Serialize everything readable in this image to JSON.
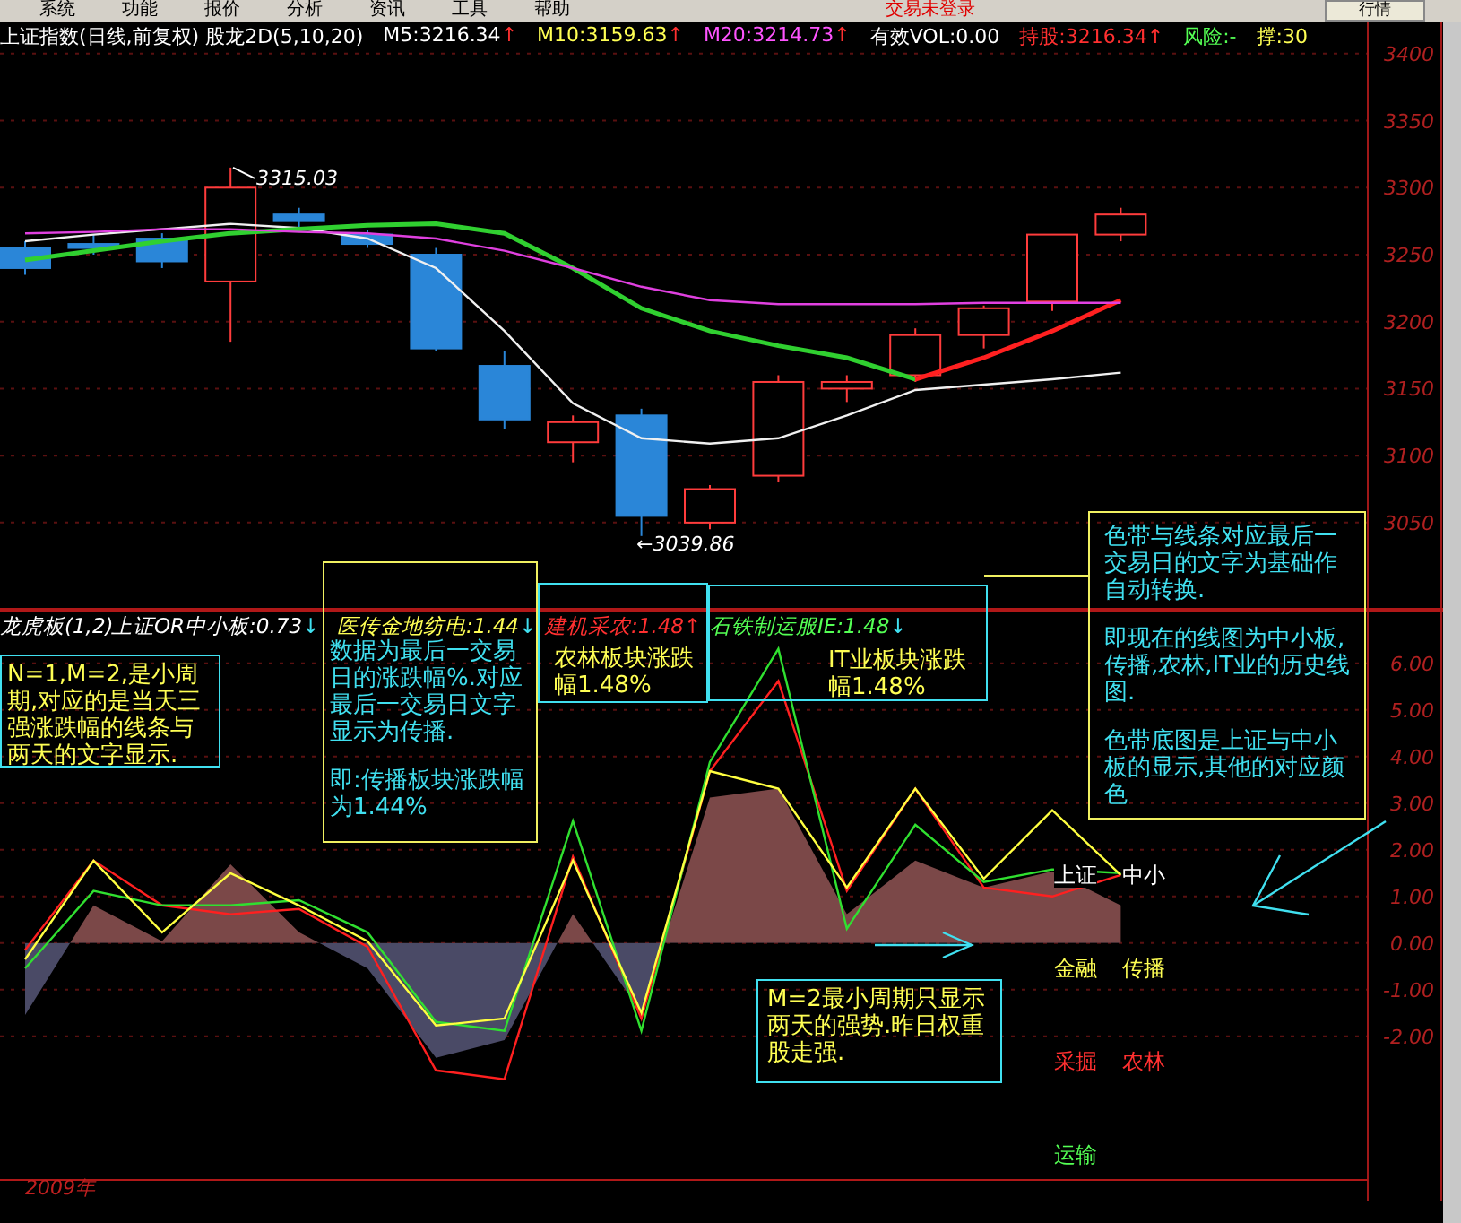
{
  "menu": {
    "items": [
      {
        "label": "系统"
      },
      {
        "label": "功能"
      },
      {
        "label": "报价"
      },
      {
        "label": "分析"
      },
      {
        "label": "资讯"
      },
      {
        "label": "工具"
      },
      {
        "label": "帮助"
      }
    ],
    "login_status": "交易未登录",
    "buttons": [
      "行情"
    ]
  },
  "header": {
    "title": "上证指数(日线,前复权) 股龙2D(5,10,20)",
    "stats": [
      {
        "label": "M5:3216.34",
        "arrow": {
          "text": "↑",
          "color": "#ff3030"
        },
        "color": "#ffffff"
      },
      {
        "label": "M10:3159.63",
        "arrow": {
          "text": "↑",
          "color": "#ff3030"
        },
        "color": "#ffff54"
      },
      {
        "label": "M20:3214.73",
        "arrow": {
          "text": "↑",
          "color": "#ff3030"
        },
        "color": "#ff54ff"
      },
      {
        "label": "有效VOL:0.00",
        "color": "#ffffff"
      },
      {
        "label": "持股:3216.34",
        "arrow": {
          "text": "↑",
          "color": "#ff3030"
        },
        "color": "#ff3030"
      },
      {
        "label": "风险:-",
        "color": "#54ff54"
      },
      {
        "label": "撑:30",
        "color": "#ffff54"
      }
    ]
  },
  "price_chart": {
    "high_label": "3315.03",
    "low_label": "←3039.86",
    "chart_data": {
      "type": "line",
      "grid": true,
      "ylim": [
        2985,
        3424
      ],
      "yticks": [
        3050,
        3100,
        3150,
        3200,
        3250,
        3300,
        3350,
        3400
      ],
      "series": [
        {
          "color": "#f0f0f0",
          "values": [
            3260,
            3265,
            3269,
            3273,
            3270,
            3262,
            3240,
            3193,
            3139,
            3113,
            3109,
            3113,
            3130,
            3149,
            3153,
            3157,
            3162
          ]
        },
        {
          "color": "#30d030",
          "values": [
            3246,
            3253,
            3260,
            3266,
            3269,
            3272,
            3273,
            3266,
            3240,
            3210,
            3193,
            3182,
            3173,
            3157,
            null,
            null,
            null
          ]
        },
        {
          "color": "#ff2020",
          "values": [
            null,
            null,
            null,
            null,
            null,
            null,
            null,
            null,
            null,
            null,
            null,
            null,
            null,
            3157,
            3173,
            3193,
            3216
          ]
        },
        {
          "color": "#e040e0",
          "values": [
            3266,
            3267,
            3269,
            3269,
            3267,
            3266,
            3262,
            3253,
            3240,
            3226,
            3216,
            3213,
            3213,
            3213,
            3214,
            3214,
            3214
          ]
        }
      ]
    }
  },
  "indicator": {
    "name": "龙虎板(1,2)",
    "values": [
      {
        "label": "上证OR中小板:0.73",
        "arrow": {
          "text": "↓",
          "color": "#40e0f0"
        },
        "color": "#ffffff"
      },
      {
        "label": "医传金地纺电:1.44",
        "arrow": {
          "text": "↓",
          "color": "#40e0f0"
        },
        "color": "#ffff54"
      },
      {
        "label": "建机采农:1.48",
        "arrow": {
          "text": "↑",
          "color": "#ff3030"
        },
        "color": "#ff3030"
      },
      {
        "label": "石铁制运服IE:1.48",
        "arrow": {
          "text": "↓",
          "color": "#40e0f0"
        },
        "color": "#54ff54"
      }
    ],
    "chart_data": {
      "type": "line",
      "grid": true,
      "ylim": [
        -5.08,
        7.15
      ],
      "yticks": [
        {
          "value": -2,
          "label": "-2.00"
        },
        {
          "value": -1,
          "label": "-1.00"
        },
        {
          "value": 0,
          "label": "0.00"
        },
        {
          "value": 1,
          "label": "1.00"
        },
        {
          "value": 2,
          "label": "2.00"
        },
        {
          "value": 3,
          "label": "3.00"
        },
        {
          "value": 4,
          "label": "4.00"
        },
        {
          "value": 5,
          "label": "5.00"
        },
        {
          "value": 6,
          "label": "6.00"
        }
      ],
      "series": [
        {
          "type": "area",
          "color": "#7b4848",
          "values": [
            -1.54,
            0.81,
            0.04,
            1.69,
            0.23,
            -0.54,
            -2.46,
            -2.08,
            0.62,
            -1.5,
            3.12,
            3.31,
            0.62,
            1.77,
            1.19,
            1.54,
            0.81
          ]
        },
        {
          "color": "#ff2020",
          "values": [
            -0.15,
            1.77,
            0.81,
            0.62,
            0.73,
            -0.08,
            -2.73,
            -2.92,
            1.85,
            -1.62,
            3.69,
            5.62,
            1.12,
            3.31,
            1.19,
            1.0,
            1.46
          ]
        },
        {
          "color": "#30e030",
          "values": [
            -0.54,
            1.12,
            0.81,
            0.81,
            0.92,
            0.23,
            -1.69,
            -1.88,
            2.62,
            -1.88,
            3.88,
            6.31,
            0.31,
            2.54,
            1.31,
            1.58,
            1.5
          ]
        },
        {
          "color": "#ffff40",
          "values": [
            -0.35,
            1.77,
            0.23,
            1.5,
            0.81,
            0.04,
            -1.77,
            -1.62,
            1.77,
            -1.5,
            3.69,
            3.31,
            1.19,
            3.31,
            1.38,
            2.85,
            1.46
          ]
        }
      ]
    },
    "legend": [
      {
        "label": "上证",
        "color": "#ffffff"
      },
      {
        "label": "中小",
        "color": "#ffffff"
      },
      {
        "label": "金融",
        "color": "#ffff54"
      },
      {
        "label": "传播",
        "color": "#ffff54"
      },
      {
        "label": "采掘",
        "color": "#ff3030"
      },
      {
        "label": "农林",
        "color": "#ff3030"
      },
      {
        "label": "运输",
        "color": "#54ff54"
      }
    ]
  },
  "notes": [
    {
      "kind": "cyan-frame",
      "paragraphs": [
        "N=1,M=2,是小周期,对应的是当天三强涨跌幅的线条与两天的文字显示."
      ]
    },
    {
      "kind": "yellow-frame",
      "paragraphs": [
        "数据为最后一交易日的涨跌幅%.对应最后一交易日文字显示为传播.",
        "即:传播板块涨跌幅为1.44%"
      ]
    },
    {
      "kind": "cyan-frame",
      "paragraphs": [
        "农林板块涨跌幅1.48%"
      ]
    },
    {
      "kind": "cyan-frame",
      "paragraphs": [
        "IT业板块涨跌幅1.48%"
      ]
    },
    {
      "kind": "yellow-frame",
      "paragraphs": [
        "色带与线条对应最后一交易日的文字为基础作自动转换.",
        "即现在的线图为中小板,传播,农林,IT业的历史线图.",
        "色带底图是上证与中小板的显示,其他的对应颜色"
      ]
    },
    {
      "kind": "cyan-frame",
      "paragraphs": [
        "M=2最小周期只显示两天的强势.昨日权重股走强."
      ]
    }
  ],
  "footer": {
    "year": "2009年"
  }
}
